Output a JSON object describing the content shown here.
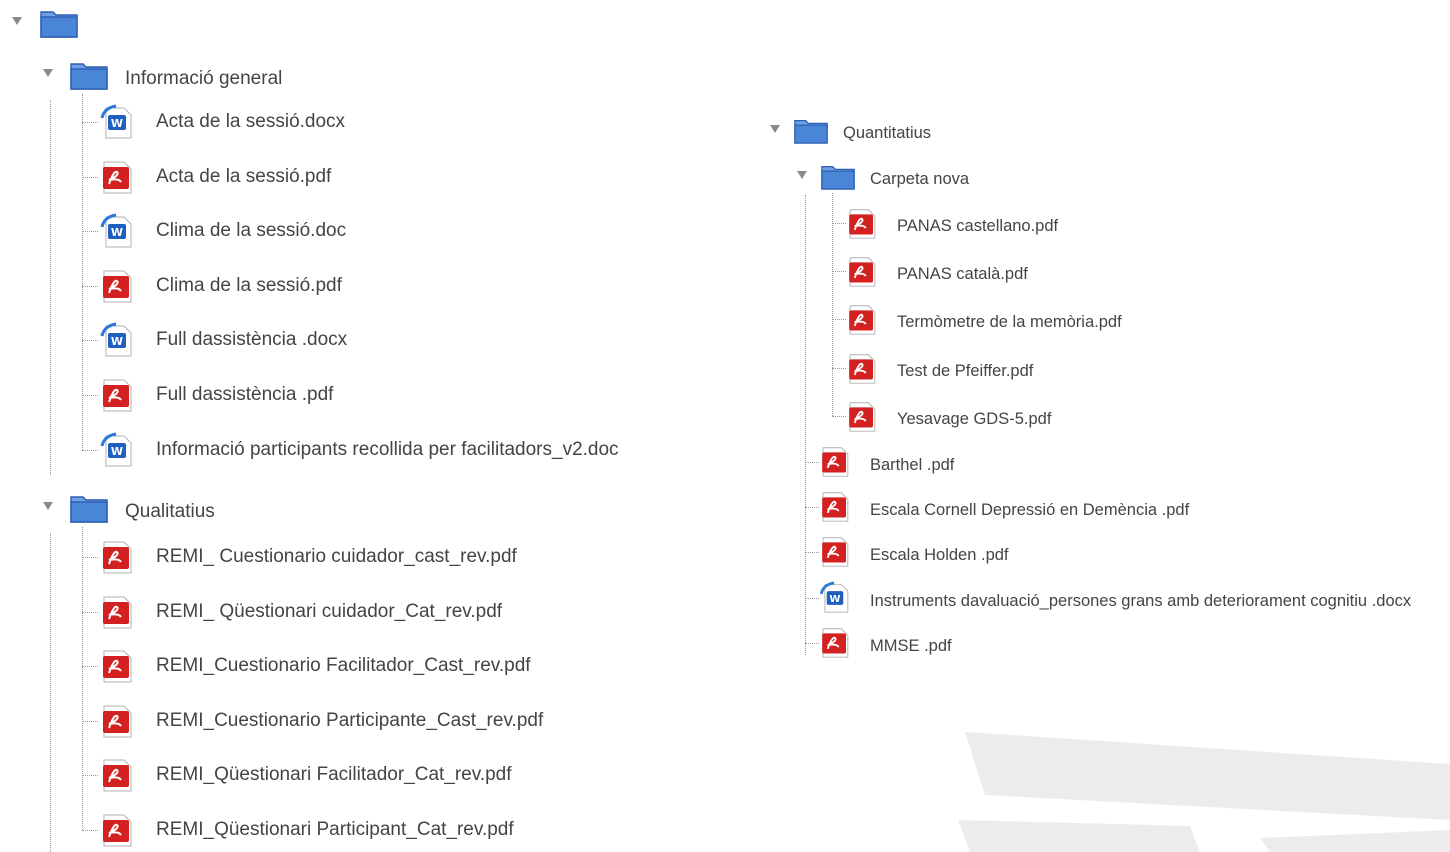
{
  "tree_left": {
    "folders": [
      {
        "name": "Informació general",
        "files": [
          {
            "name": "Acta de la sessió.docx",
            "type": "word"
          },
          {
            "name": "Acta de la sessió.pdf",
            "type": "pdf"
          },
          {
            "name": "Clima de la sessió.doc",
            "type": "word"
          },
          {
            "name": "Clima de la sessió.pdf",
            "type": "pdf"
          },
          {
            "name": "Full dassistència .docx",
            "type": "word"
          },
          {
            "name": "Full dassistència .pdf",
            "type": "pdf"
          },
          {
            "name": "Informació participants recollida per facilitadors_v2.doc",
            "type": "word"
          }
        ]
      },
      {
        "name": "Qualitatius",
        "files": [
          {
            "name": "REMI_ Cuestionario cuidador_cast_rev.pdf",
            "type": "pdf"
          },
          {
            "name": "REMI_ Qüestionari cuidador_Cat_rev.pdf",
            "type": "pdf"
          },
          {
            "name": "REMI_Cuestionario Facilitador_Cast_rev.pdf",
            "type": "pdf"
          },
          {
            "name": "REMI_Cuestionario Participante_Cast_rev.pdf",
            "type": "pdf"
          },
          {
            "name": "REMI_Qüestionari Facilitador_Cat_rev.pdf",
            "type": "pdf"
          },
          {
            "name": "REMI_Qüestionari Participant_Cat_rev.pdf",
            "type": "pdf"
          }
        ]
      }
    ]
  },
  "tree_right": {
    "folder": "Quantitatius",
    "subfolder": {
      "name": "Carpeta nova",
      "files": [
        {
          "name": "PANAS castellano.pdf",
          "type": "pdf"
        },
        {
          "name": "PANAS català.pdf",
          "type": "pdf"
        },
        {
          "name": "Termòmetre de la memòria.pdf",
          "type": "pdf"
        },
        {
          "name": "Test de Pfeiffer.pdf",
          "type": "pdf"
        },
        {
          "name": "Yesavage GDS-5.pdf",
          "type": "pdf"
        }
      ]
    },
    "files": [
      {
        "name": "Barthel .pdf",
        "type": "pdf"
      },
      {
        "name": "Escala Cornell Depressió en Demència .pdf",
        "type": "pdf"
      },
      {
        "name": "Escala Holden .pdf",
        "type": "pdf"
      },
      {
        "name": "Instruments davaluació_persones grans amb deteriorament cognitiu .docx",
        "type": "word"
      },
      {
        "name": "MMSE .pdf",
        "type": "pdf"
      }
    ]
  },
  "icons": {
    "toggle": "triangle-down-icon",
    "folder": "folder-icon",
    "pdf": "pdf-file-icon",
    "word": "word-file-icon"
  },
  "colors": {
    "folder": "#4a86d8",
    "pdf": "#d32020",
    "word": "#1f5fbf",
    "text": "#444444"
  }
}
